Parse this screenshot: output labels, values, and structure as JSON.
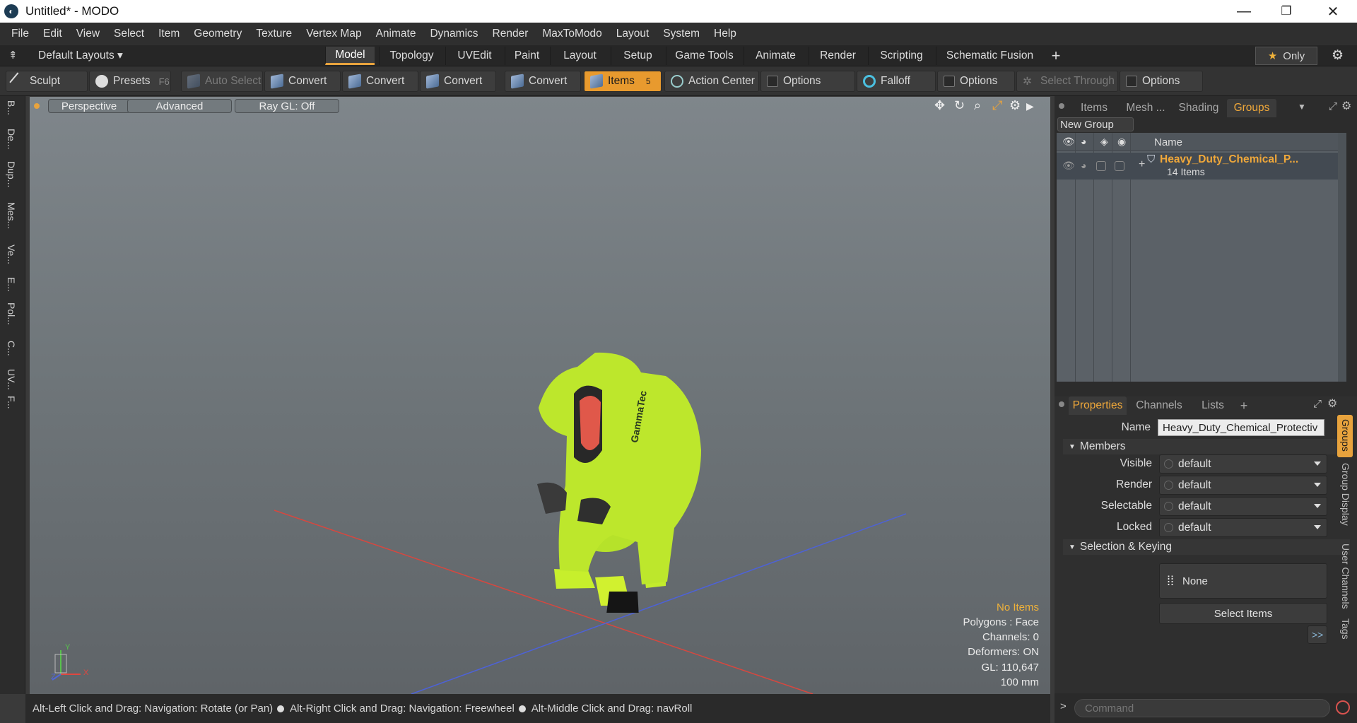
{
  "window": {
    "title": "Untitled* - MODO",
    "minimize": "—",
    "restore": "❐",
    "close": "✕"
  },
  "menu": [
    "File",
    "Edit",
    "View",
    "Select",
    "Item",
    "Geometry",
    "Texture",
    "Vertex Map",
    "Animate",
    "Dynamics",
    "Render",
    "MaxToModo",
    "Layout",
    "System",
    "Help"
  ],
  "layoutbar": {
    "layouts_label": "Default Layouts",
    "tabs": [
      "Model",
      "Topology",
      "UVEdit",
      "Paint",
      "Layout",
      "Setup",
      "Game Tools",
      "Animate",
      "Render",
      "Scripting",
      "Schematic Fusion"
    ],
    "active_tab": "Model",
    "add": "+",
    "only_label": "Only"
  },
  "toolbar": {
    "sculpt": "Sculpt",
    "presets": "Presets",
    "presets_key": "F6",
    "auto_select": "Auto Select",
    "convert1": "Convert",
    "convert2": "Convert",
    "convert3": "Convert",
    "convert4": "Convert",
    "items": "Items",
    "items_key": "5",
    "action_center": "Action Center",
    "options1": "Options",
    "falloff": "Falloff",
    "options2": "Options",
    "select_through": "Select Through",
    "options3": "Options"
  },
  "leftstrip": [
    "B...",
    "De...",
    "Dup...",
    "Mes...",
    "Ve...",
    "E...",
    "Pol...",
    "C...",
    "UV...",
    "F..."
  ],
  "viewport": {
    "perspective": "Perspective",
    "advanced": "Advanced",
    "raygl": "Ray GL: Off",
    "stats": {
      "selection": "No Items",
      "polygons": "Polygons : Face",
      "channels": "Channels: 0",
      "deformers": "Deformers: ON",
      "gl": "GL: 110,647",
      "scale": "100 mm"
    },
    "suit_brand": "GammaTec",
    "axis_y": "Y",
    "axis_x": "X",
    "axis_z": "Z"
  },
  "statusbar": {
    "hint1": "Alt-Left Click and Drag: Navigation: Rotate (or Pan)",
    "hint2": "Alt-Right Click and Drag: Navigation: Freewheel",
    "hint3": "Alt-Middle Click and Drag: navRoll"
  },
  "rightpanel": {
    "tabs": [
      "Items",
      "Mesh ...",
      "Shading",
      "Groups"
    ],
    "active_tab": "Groups",
    "new_group": "New Group",
    "col_name": "Name",
    "group_name": "Heavy_Duty_Chemical_P...",
    "group_count": "14 Items",
    "prop_tabs": [
      "Properties",
      "Channels",
      "Lists"
    ],
    "prop_add": "+",
    "name_label": "Name",
    "name_value": "Heavy_Duty_Chemical_Protectiv",
    "members_label": "Members",
    "fields": [
      {
        "label": "Visible",
        "value": "default"
      },
      {
        "label": "Render",
        "value": "default"
      },
      {
        "label": "Selectable",
        "value": "default"
      },
      {
        "label": "Locked",
        "value": "default"
      }
    ],
    "sel_keying_label": "Selection & Keying",
    "none_label": "None",
    "select_items": "Select Items",
    "more": ">>",
    "side_tabs": [
      "Groups",
      "Group Display",
      "User Channels",
      "Tags"
    ],
    "command_placeholder": "Command"
  }
}
